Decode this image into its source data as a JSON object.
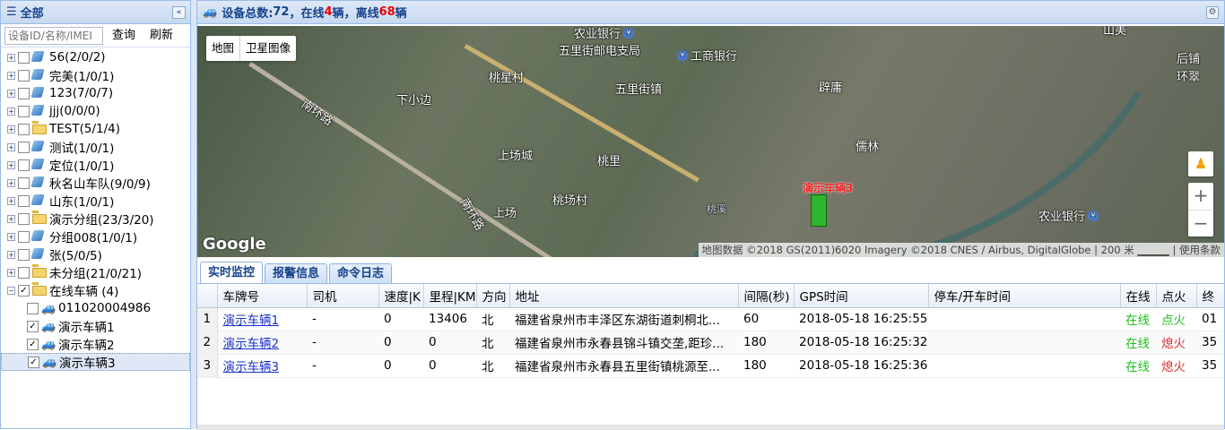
{
  "left_panel": {
    "title": "全部",
    "search_placeholder": "设备ID/名称/IMEI",
    "query_label": "查询",
    "refresh_label": "刷新",
    "groups": [
      {
        "label": "56(2/0/2)",
        "icon": "vehicle-group-icon",
        "expanded": false,
        "checked": false
      },
      {
        "label": "完美(1/0/1)",
        "icon": "vehicle-group-icon",
        "expanded": false,
        "checked": false
      },
      {
        "label": "123(7/0/7)",
        "icon": "vehicle-group-icon",
        "expanded": false,
        "checked": false
      },
      {
        "label": "jjj(0/0/0)",
        "icon": "vehicle-group-icon",
        "expanded": false,
        "checked": false
      },
      {
        "label": "TEST(5/1/4)",
        "icon": "folder-icon",
        "expanded": false,
        "checked": false
      },
      {
        "label": "测试(1/0/1)",
        "icon": "vehicle-group-icon",
        "expanded": false,
        "checked": false
      },
      {
        "label": "定位(1/0/1)",
        "icon": "vehicle-group-icon",
        "expanded": false,
        "checked": false
      },
      {
        "label": "秋名山车队(9/0/9)",
        "icon": "vehicle-group-icon",
        "expanded": false,
        "checked": false
      },
      {
        "label": "山东(1/0/1)",
        "icon": "vehicle-group-icon",
        "expanded": false,
        "checked": false
      },
      {
        "label": "演示分组(23/3/20)",
        "icon": "folder-icon",
        "expanded": false,
        "checked": false
      },
      {
        "label": "分组008(1/0/1)",
        "icon": "vehicle-group-icon",
        "expanded": false,
        "checked": false
      },
      {
        "label": "张(5/0/5)",
        "icon": "vehicle-group-icon",
        "expanded": false,
        "checked": false
      },
      {
        "label": "未分组(21/0/21)",
        "icon": "folder-icon",
        "expanded": false,
        "checked": false
      },
      {
        "label": "在线车辆 (4)",
        "icon": "folder-icon",
        "expanded": true,
        "checked": true
      }
    ],
    "online_children": [
      {
        "label": "011020004986",
        "checked": false,
        "selected": false
      },
      {
        "label": "演示车辆1",
        "checked": true,
        "selected": false
      },
      {
        "label": "演示车辆2",
        "checked": true,
        "selected": false
      },
      {
        "label": "演示车辆3",
        "checked": true,
        "selected": true
      }
    ]
  },
  "header": {
    "prefix": "设备总数:",
    "total": "72",
    "online_prefix": "，在线",
    "online_count": "4",
    "unit1": "辆",
    "offline_prefix": "，离线",
    "offline_count": "68",
    "unit2": "辆"
  },
  "map": {
    "map_button": "地图",
    "satellite_button": "卫星图像",
    "logo": "Google",
    "attribution": "地图数据 ©2018 GS(2011)6020 Imagery ©2018 CNES / Airbus, DigitalGlobe | 200 米 ▁▁▁▁ | 使用条款",
    "zoom_in": "+",
    "zoom_out": "−",
    "vehicle_label": "演示车辆3",
    "labels": [
      "农业银行",
      "五里街邮电支局",
      "工商银行",
      "桃星村",
      "五里街镇",
      "下小边",
      "南环路",
      "辟庸",
      "上场城",
      "儒林",
      "桃里",
      "桃场村",
      "上场",
      "南环路",
      "桃溪",
      "农业银行",
      "山美",
      "后铺",
      "环翠"
    ]
  },
  "tabs": [
    "实时监控",
    "报警信息",
    "命令日志"
  ],
  "table": {
    "columns": [
      "车牌号",
      "司机",
      "速度|K",
      "里程|KM",
      "方向",
      "地址",
      "间隔(秒)",
      "GPS时间",
      "停车/开车时间",
      "在线",
      "点火",
      "终"
    ],
    "rows": [
      {
        "n": "1",
        "plate": "演示车辆1",
        "driver": "-",
        "speed": "0",
        "mileage": "13406",
        "dir": "北",
        "addr": "福建省泉州市丰泽区东湖街道刺桐北...",
        "interval": "60",
        "gps": "2018-05-18 16:25:55",
        "park": "",
        "online": "在线",
        "ign": "点火",
        "term": "01"
      },
      {
        "n": "2",
        "plate": "演示车辆2",
        "driver": "-",
        "speed": "0",
        "mileage": "0",
        "dir": "北",
        "addr": "福建省泉州市永春县锦斗镇交垄,距珍...",
        "interval": "180",
        "gps": "2018-05-18 16:25:32",
        "park": "",
        "online": "在线",
        "ign": "熄火",
        "term": "35"
      },
      {
        "n": "3",
        "plate": "演示车辆3",
        "driver": "-",
        "speed": "0",
        "mileage": "0",
        "dir": "北",
        "addr": "福建省泉州市永春县五里街镇桃源至...",
        "interval": "180",
        "gps": "2018-05-18 16:25:36",
        "park": "",
        "online": "在线",
        "ign": "熄火",
        "term": "35"
      }
    ]
  },
  "colors": {
    "header_text": "#15428b",
    "online": "#1fbd1f",
    "offline": "#e03030",
    "link": "#1a31c8"
  }
}
